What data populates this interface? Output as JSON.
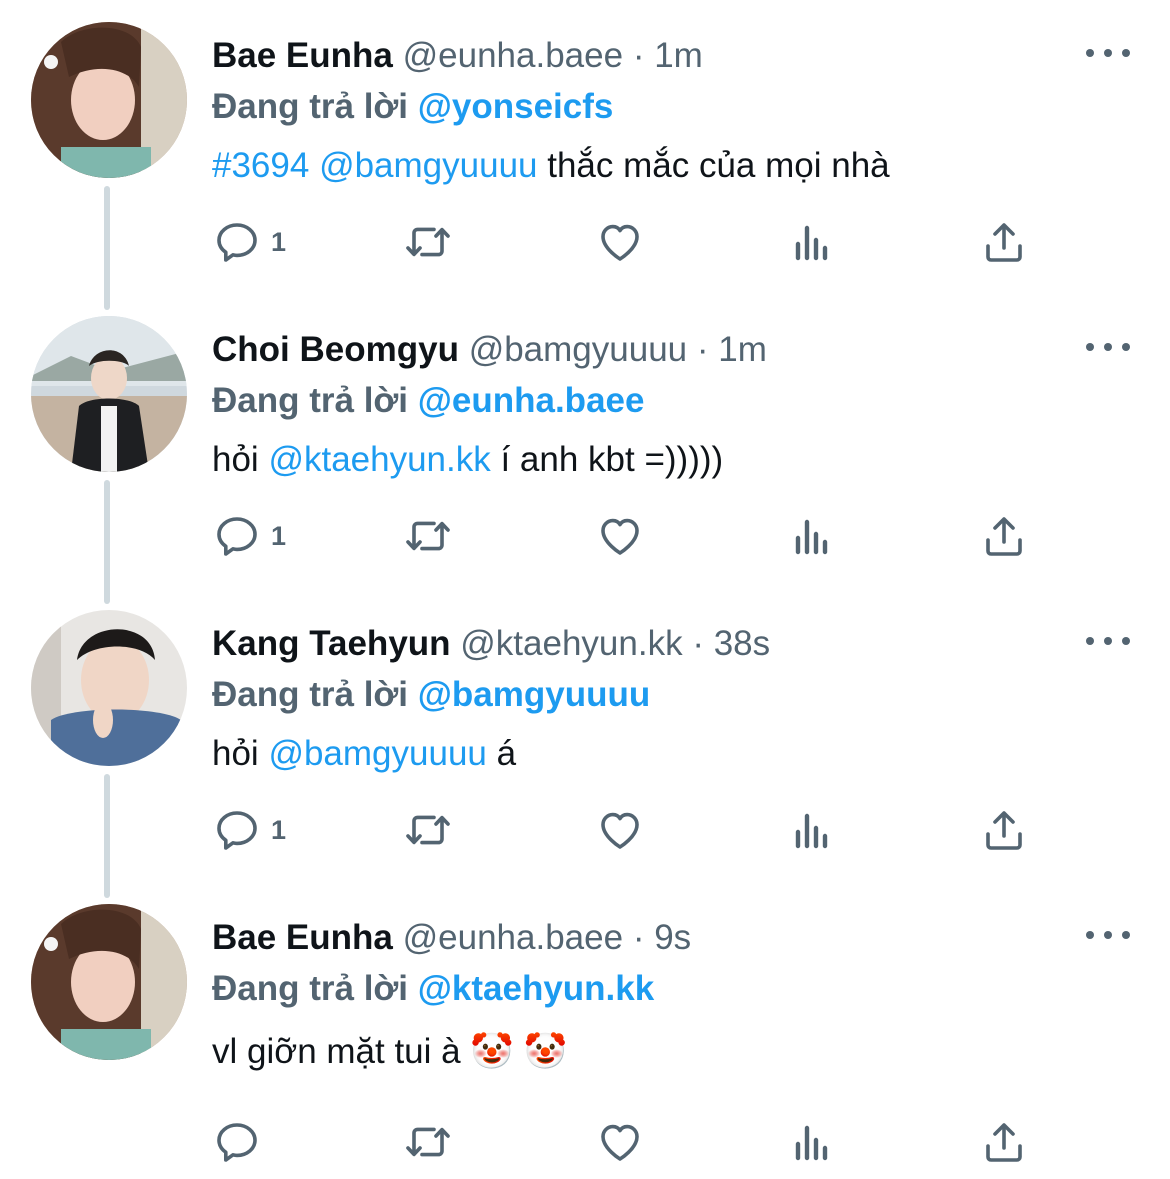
{
  "colors": {
    "link": "#1d9bf0",
    "muted": "#536471",
    "text": "#0f1419",
    "thread_line": "#cfd9de"
  },
  "tweets": [
    {
      "name": "Bae Eunha",
      "handle": "@eunha.baee",
      "separator": "·",
      "time": "1m",
      "replying_prefix": "Đang trả lời",
      "replying_to": "@yonseicfs",
      "body": {
        "hashtag": "#3694",
        "space1": " ",
        "mention": "@bamgyuuuu",
        "text": " thắc mắc của mọi nhà"
      },
      "reply_count": "1"
    },
    {
      "name": "Choi Beomgyu",
      "handle": "@bamgyuuuu",
      "separator": "·",
      "time": "1m",
      "replying_prefix": "Đang trả lời",
      "replying_to": "@eunha.baee",
      "body": {
        "before": "hỏi ",
        "mention": "@ktaehyun.kk",
        "after": " í anh kbt =)))))"
      },
      "reply_count": "1"
    },
    {
      "name": "Kang Taehyun",
      "handle": "@ktaehyun.kk",
      "separator": "·",
      "time": "38s",
      "replying_prefix": "Đang trả lời",
      "replying_to": "@bamgyuuuu",
      "body": {
        "before": "hỏi ",
        "mention": "@bamgyuuuu",
        "after": " á"
      },
      "reply_count": "1"
    },
    {
      "name": "Bae Eunha",
      "handle": "@eunha.baee",
      "separator": "·",
      "time": "9s",
      "replying_prefix": "Đang trả lời",
      "replying_to": "@ktaehyun.kk",
      "body": {
        "text": "vl giỡn mặt tui à 🤡 🤡"
      },
      "reply_count": ""
    }
  ],
  "icons": [
    "reply-icon",
    "retweet-icon",
    "like-icon",
    "analytics-icon",
    "share-icon",
    "more-icon"
  ]
}
